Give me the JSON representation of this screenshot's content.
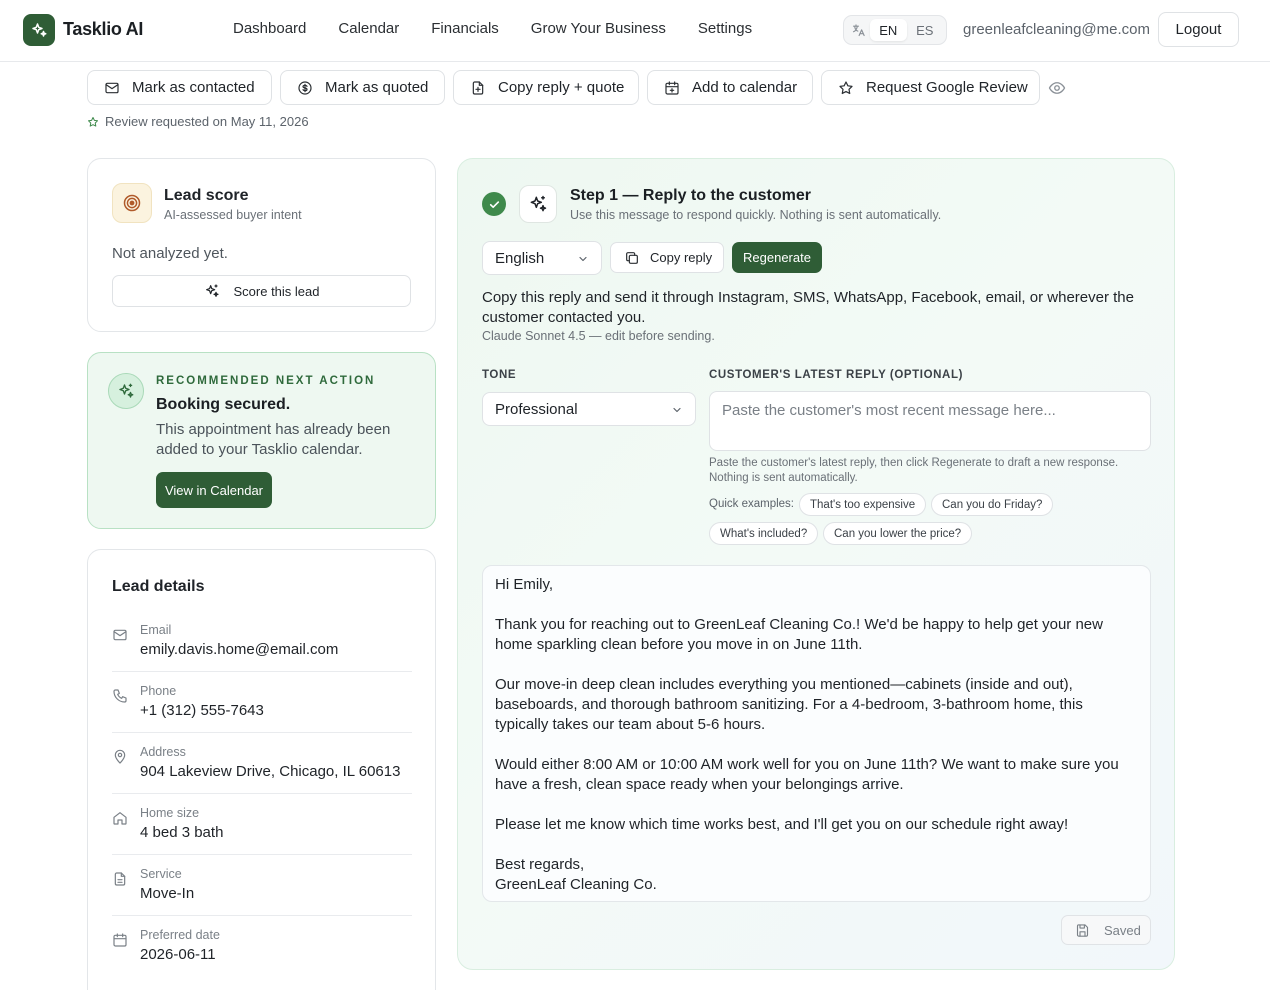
{
  "app": {
    "brand": "Tasklio AI",
    "nav": [
      "Dashboard",
      "Calendar",
      "Financials",
      "Grow Your Business",
      "Settings"
    ],
    "languages": [
      "EN",
      "ES"
    ],
    "active_language": "EN",
    "user_email": "greenleafcleaning@me.com",
    "logout_label": "Logout"
  },
  "actions": {
    "mark_contacted": "Mark as contacted",
    "mark_quoted": "Mark as quoted",
    "copy_reply_quote": "Copy reply + quote",
    "add_calendar": "Add to calendar",
    "request_review": "Request Google Review",
    "review_note": "Review requested on May 11, 2026"
  },
  "lead_score": {
    "title": "Lead score",
    "subtitle": "AI-assessed buyer intent",
    "status": "Not analyzed yet.",
    "button": "Score this lead"
  },
  "recommendation": {
    "kicker": "RECOMMENDED NEXT ACTION",
    "title": "Booking secured.",
    "text": "This appointment has already been added to your Tasklio calendar.",
    "button": "View in Calendar"
  },
  "lead_details": {
    "title": "Lead details",
    "rows": [
      {
        "label": "Email",
        "value": "emily.davis.home@email.com",
        "icon": "mail-icon"
      },
      {
        "label": "Phone",
        "value": "+1 (312) 555-7643",
        "icon": "phone-icon"
      },
      {
        "label": "Address",
        "value": "904 Lakeview Drive, Chicago, IL 60613",
        "icon": "map-pin-icon"
      },
      {
        "label": "Home size",
        "value": "4 bed 3 bath",
        "icon": "home-icon"
      },
      {
        "label": "Service",
        "value": "Move-In",
        "icon": "file-icon"
      },
      {
        "label": "Preferred date",
        "value": "2026-06-11",
        "icon": "calendar-icon"
      }
    ]
  },
  "reply": {
    "step_title": "Step 1 — Reply to the customer",
    "step_subtitle": "Use this message to respond quickly. Nothing is sent automatically.",
    "language": "English",
    "copy_label": "Copy reply",
    "regenerate_label": "Regenerate",
    "instructions": "Copy this reply and send it through Instagram, SMS, WhatsApp, Facebook, email, or wherever the customer contacted you.",
    "model_note": "Claude Sonnet 4.5 — edit before sending.",
    "tone_label": "TONE",
    "tone_value": "Professional",
    "customer_label": "CUSTOMER'S LATEST REPLY (OPTIONAL)",
    "customer_placeholder": "Paste the customer's most recent message here...",
    "help_text": "Paste the customer's latest reply, then click Regenerate to draft a new response. Nothing is sent automatically.",
    "quick_label": "Quick examples:",
    "quick_examples": [
      "That's too expensive",
      "Can you do Friday?",
      "What's included?",
      "Can you lower the price?"
    ],
    "draft_lines": [
      "Hi Emily,",
      "",
      "Thank you for reaching out to GreenLeaf Cleaning Co.! We'd be happy to help get your new home sparkling clean before you move in on June 11th.",
      "",
      "Our move-in deep clean includes everything you mentioned—cabinets (inside and out), baseboards, and thorough bathroom sanitizing. For a 4-bedroom, 3-bathroom home, this typically takes our team about 5-6 hours.",
      "",
      "Would either 8:00 AM or 10:00 AM work well for you on June 11th? We want to make sure you have a fresh, clean space ready when your belongings arrive.",
      "",
      "Please let me know which time works best, and I'll get you on our schedule right away!",
      "",
      "Best regards,",
      "GreenLeaf Cleaning Co."
    ],
    "saved_label": "Saved"
  },
  "colors": {
    "brand_green": "#2f5d36",
    "success_green": "#3f8a4c",
    "recommend_bg": "#eef8f1"
  }
}
